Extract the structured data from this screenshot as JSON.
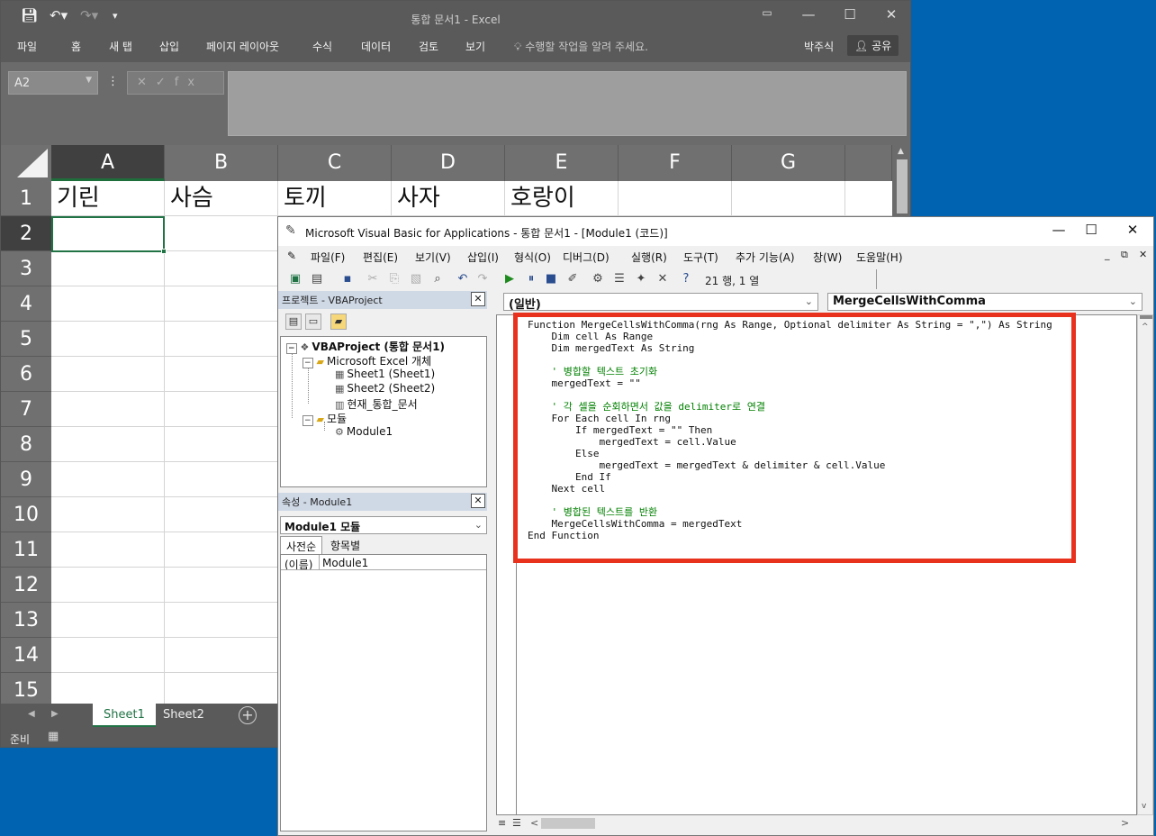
{
  "excel": {
    "title": "통합 문서1 - Excel",
    "ribbon_tabs": [
      "파일",
      "홈",
      "새 탭",
      "삽입",
      "페이지 레이아웃",
      "수식",
      "데이터",
      "검토",
      "보기"
    ],
    "tell_me": "수행할 작업을 알려 주세요.",
    "user": "박주식",
    "share": "공유",
    "name_box": "A2",
    "fx_buttons": "✕✓fx",
    "columns": [
      "A",
      "B",
      "C",
      "D",
      "E",
      "F",
      "G"
    ],
    "rows": [
      "1",
      "2",
      "3",
      "4",
      "5",
      "6",
      "7",
      "8",
      "9",
      "10",
      "11",
      "12",
      "13",
      "14",
      "15"
    ],
    "row1_values": [
      "기린",
      "사슴",
      "토끼",
      "사자",
      "호랑이"
    ],
    "sheets": [
      "Sheet1",
      "Sheet2"
    ],
    "status": "준비"
  },
  "vbe": {
    "title": "Microsoft Visual Basic for Applications - 통합 문서1 - [Module1 (코드)]",
    "menus": [
      "파일(F)",
      "편집(E)",
      "보기(V)",
      "삽입(I)",
      "형식(O)",
      "디버그(D)",
      "실행(R)",
      "도구(T)",
      "추가 기능(A)",
      "창(W)",
      "도움말(H)"
    ],
    "cursor_position": "21 행, 1 열",
    "project_title": "프로젝트 - VBAProject",
    "tree": {
      "root": "VBAProject (통합 문서1)",
      "folder_objects": "Microsoft Excel 개체",
      "sheet1": "Sheet1 (Sheet1)",
      "sheet2": "Sheet2 (Sheet2)",
      "thisworkbook": "현재_통합_문서",
      "folder_modules": "모듈",
      "module1": "Module1"
    },
    "props_title": "속성 - Module1",
    "props_object": "Module1 모듈",
    "props_tabs": [
      "사전순",
      "항목별"
    ],
    "props_key": "(이름)",
    "props_value": "Module1",
    "object_combo": "(일반)",
    "proc_combo": "MergeCellsWithComma",
    "code_lines": [
      {
        "cls": "kw",
        "text": "Function MergeCellsWithComma(rng As Range, Optional delimiter As String = \",\") As String"
      },
      {
        "cls": "kw",
        "text": "    Dim cell As Range"
      },
      {
        "cls": "kw",
        "text": "    Dim mergedText As String"
      },
      {
        "cls": "",
        "text": ""
      },
      {
        "cls": "c",
        "text": "    ' 병합할 텍스트 초기화"
      },
      {
        "cls": "",
        "text": "    mergedText = \"\""
      },
      {
        "cls": "",
        "text": ""
      },
      {
        "cls": "c",
        "text": "    ' 각 셀을 순회하면서 값을 delimiter로 연결"
      },
      {
        "cls": "kw",
        "text": "    For Each cell In rng"
      },
      {
        "cls": "kw",
        "text": "        If mergedText = \"\" Then"
      },
      {
        "cls": "",
        "text": "            mergedText = cell.Value"
      },
      {
        "cls": "kw",
        "text": "        Else"
      },
      {
        "cls": "",
        "text": "            mergedText = mergedText & delimiter & cell.Value"
      },
      {
        "cls": "kw",
        "text": "        End If"
      },
      {
        "cls": "kw",
        "text": "    Next cell"
      },
      {
        "cls": "",
        "text": ""
      },
      {
        "cls": "c",
        "text": "    ' 병합된 텍스트를 반환"
      },
      {
        "cls": "",
        "text": "    MergeCellsWithComma = mergedText"
      },
      {
        "cls": "kw",
        "text": "End Function"
      }
    ],
    "highlight_color": "#e8321d"
  }
}
